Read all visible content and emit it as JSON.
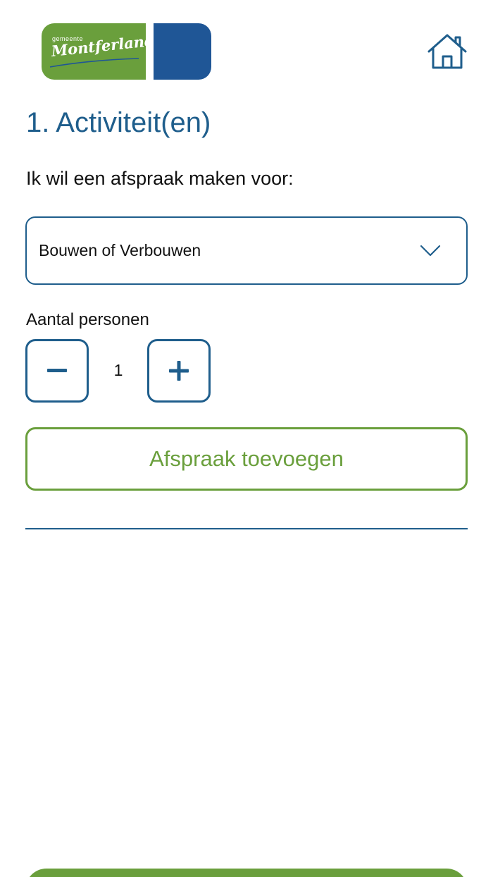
{
  "logo": {
    "small_text": "gemeente",
    "main_text": "Montferland",
    "colors": {
      "green": "#6a9f3c",
      "blue": "#1f5696"
    }
  },
  "header": {
    "home_icon": "home-icon"
  },
  "section": {
    "title": "1. Activiteit(en)",
    "intro": "Ik wil een afspraak maken voor:"
  },
  "activity_select": {
    "selected": "Bouwen of Verbouwen",
    "icon": "chevron-down-icon"
  },
  "persons": {
    "label": "Aantal personen",
    "value": "1",
    "minus_icon": "minus-icon",
    "plus_icon": "plus-icon"
  },
  "add_button": {
    "label": "Afspraak toevoegen"
  },
  "colors": {
    "primary": "#1f5e8c",
    "accent": "#6a9f3c"
  }
}
